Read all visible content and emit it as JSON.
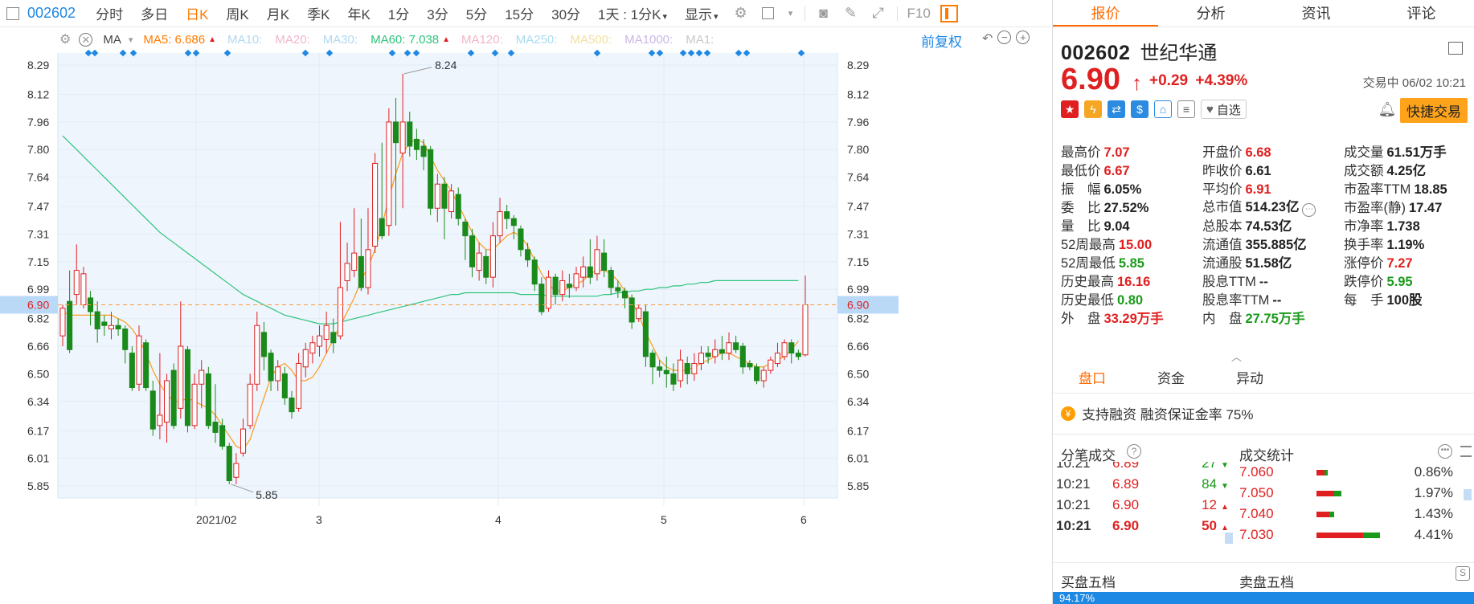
{
  "toolbar": {
    "code": "002602",
    "items": [
      {
        "label": "分时",
        "active": false
      },
      {
        "label": "多日",
        "active": false
      },
      {
        "label": "日K",
        "active": true
      },
      {
        "label": "周K",
        "active": false
      },
      {
        "label": "月K",
        "active": false
      },
      {
        "label": "季K",
        "active": false
      },
      {
        "label": "年K",
        "active": false
      },
      {
        "label": "1分",
        "active": false
      },
      {
        "label": "3分",
        "active": false
      },
      {
        "label": "5分",
        "active": false
      },
      {
        "label": "15分",
        "active": false
      },
      {
        "label": "30分",
        "active": false
      }
    ],
    "dropdown": "1天 : 1分K",
    "display": "显示",
    "f10": "F10"
  },
  "ma_bar": {
    "ma_label": "MA",
    "ma5": {
      "label": "MA5: 6.686",
      "color": "#ff7a00"
    },
    "ma10": {
      "label": "MA10:",
      "color": "#b0d8f0"
    },
    "ma20": {
      "label": "MA20:",
      "color": "#f3b5d0"
    },
    "ma30": {
      "label": "MA30:",
      "color": "#b0d8f0"
    },
    "ma60": {
      "label": "MA60: 7.038",
      "color": "#2ec47b"
    },
    "ma120": {
      "label": "MA120:",
      "color": "#f3b5c4"
    },
    "ma250": {
      "label": "MA250:",
      "color": "#a8dcf0"
    },
    "ma500": {
      "label": "MA500:",
      "color": "#f3e0a0"
    },
    "ma1000": {
      "label": "MA1000:",
      "color": "#c8b8e8"
    },
    "ma1": {
      "label": "MA1:",
      "color": "#c8c8c8"
    },
    "adjust": "前复权"
  },
  "chart_data": {
    "type": "candlestick",
    "y_ticks": [
      "8.29",
      "8.12",
      "7.96",
      "7.80",
      "7.64",
      "7.47",
      "7.31",
      "7.15",
      "6.99",
      "6.82",
      "6.66",
      "6.50",
      "6.34",
      "6.17",
      "6.01",
      "5.85"
    ],
    "y_range": [
      5.78,
      8.36
    ],
    "x_labels": [
      "2021/02",
      "3",
      "4",
      "5",
      "6"
    ],
    "current_price_label": "6.90",
    "current_price": 6.9,
    "max_label": "8.24",
    "min_label": "5.85",
    "candles": [
      [
        6.72,
        6.88,
        6.66,
        6.9
      ],
      [
        6.92,
        6.64,
        6.62,
        7.1
      ],
      [
        6.96,
        7.1,
        6.9,
        7.25
      ],
      [
        6.9,
        7.08,
        6.88,
        7.12
      ],
      [
        6.94,
        6.86,
        6.78,
        6.98
      ],
      [
        6.86,
        6.76,
        6.68,
        6.92
      ],
      [
        6.8,
        6.78,
        6.72,
        6.84
      ],
      [
        6.76,
        6.78,
        6.7,
        6.86
      ],
      [
        6.78,
        6.76,
        6.72,
        6.82
      ],
      [
        6.76,
        6.64,
        6.56,
        6.78
      ],
      [
        6.62,
        6.42,
        6.4,
        6.66
      ],
      [
        6.44,
        6.72,
        6.4,
        6.78
      ],
      [
        6.68,
        6.42,
        6.4,
        6.7
      ],
      [
        6.4,
        6.18,
        6.14,
        6.46
      ],
      [
        6.2,
        6.26,
        6.12,
        6.62
      ],
      [
        6.22,
        6.46,
        6.1,
        6.5
      ],
      [
        6.52,
        6.2,
        6.18,
        6.56
      ],
      [
        6.3,
        6.66,
        6.24,
        6.92
      ],
      [
        6.64,
        6.2,
        6.16,
        6.66
      ],
      [
        6.2,
        6.44,
        6.18,
        6.5
      ],
      [
        6.44,
        6.52,
        6.3,
        6.58
      ],
      [
        6.5,
        6.2,
        6.18,
        6.54
      ],
      [
        6.22,
        6.16,
        6.1,
        6.44
      ],
      [
        6.2,
        6.08,
        6.06,
        6.24
      ],
      [
        6.08,
        5.88,
        5.86,
        6.1
      ],
      [
        5.9,
        5.98,
        5.86,
        6.04
      ],
      [
        6.04,
        6.18,
        6.02,
        6.24
      ],
      [
        6.2,
        6.44,
        6.18,
        6.5
      ],
      [
        6.44,
        6.78,
        6.4,
        6.86
      ],
      [
        6.74,
        6.6,
        6.52,
        6.8
      ],
      [
        6.62,
        6.46,
        6.4,
        6.64
      ],
      [
        6.46,
        6.54,
        6.4,
        6.58
      ],
      [
        6.5,
        6.36,
        6.32,
        6.54
      ],
      [
        6.36,
        6.28,
        6.24,
        6.4
      ],
      [
        6.3,
        6.56,
        6.28,
        6.62
      ],
      [
        6.54,
        6.64,
        6.48,
        6.68
      ],
      [
        6.62,
        6.68,
        6.56,
        6.72
      ],
      [
        6.66,
        6.72,
        6.6,
        6.78
      ],
      [
        6.7,
        6.78,
        6.62,
        6.86
      ],
      [
        6.74,
        6.68,
        6.62,
        6.82
      ],
      [
        6.72,
        7.0,
        6.7,
        7.38
      ],
      [
        7.04,
        7.14,
        6.98,
        7.26
      ],
      [
        7.1,
        7.2,
        7.06,
        7.46
      ],
      [
        7.18,
        7.0,
        6.98,
        7.4
      ],
      [
        7.0,
        7.22,
        6.96,
        7.46
      ],
      [
        7.24,
        7.72,
        7.2,
        7.78
      ],
      [
        7.4,
        7.3,
        7.28,
        7.84
      ],
      [
        7.36,
        7.96,
        7.3,
        8.04
      ],
      [
        7.96,
        7.84,
        7.36,
        8.1
      ],
      [
        7.78,
        7.96,
        7.46,
        8.24
      ],
      [
        7.96,
        7.82,
        7.76,
        8.02
      ],
      [
        7.86,
        7.8,
        7.74,
        7.92
      ],
      [
        7.82,
        7.76,
        7.68,
        7.86
      ],
      [
        7.8,
        7.46,
        7.42,
        7.82
      ],
      [
        7.46,
        7.6,
        7.38,
        7.66
      ],
      [
        7.6,
        7.46,
        7.28,
        7.64
      ],
      [
        7.44,
        7.56,
        7.4,
        7.6
      ],
      [
        7.54,
        7.4,
        7.36,
        7.58
      ],
      [
        7.38,
        7.3,
        7.16,
        7.4
      ],
      [
        7.3,
        7.12,
        7.06,
        7.34
      ],
      [
        7.1,
        7.2,
        7.04,
        7.26
      ],
      [
        7.18,
        7.06,
        7.02,
        7.22
      ],
      [
        7.06,
        7.3,
        7.0,
        7.38
      ],
      [
        7.3,
        7.44,
        7.26,
        7.52
      ],
      [
        7.44,
        7.4,
        7.34,
        7.48
      ],
      [
        7.4,
        7.36,
        7.28,
        7.42
      ],
      [
        7.34,
        7.22,
        7.18,
        7.36
      ],
      [
        7.22,
        7.16,
        7.12,
        7.26
      ],
      [
        7.16,
        7.02,
        6.98,
        7.18
      ],
      [
        7.02,
        6.86,
        6.84,
        7.06
      ],
      [
        6.88,
        7.06,
        6.86,
        7.1
      ],
      [
        7.06,
        6.96,
        6.9,
        7.08
      ],
      [
        6.96,
        7.04,
        6.92,
        7.1
      ],
      [
        7.02,
        7.0,
        6.94,
        7.08
      ],
      [
        7.0,
        7.08,
        6.98,
        7.12
      ],
      [
        7.06,
        7.12,
        7.0,
        7.18
      ],
      [
        7.12,
        7.06,
        7.02,
        7.28
      ],
      [
        7.08,
        7.22,
        7.04,
        7.3
      ],
      [
        7.2,
        7.1,
        7.06,
        7.28
      ],
      [
        7.1,
        7.0,
        6.96,
        7.12
      ],
      [
        7.0,
        6.98,
        6.94,
        7.04
      ],
      [
        6.98,
        6.94,
        6.88,
        7.0
      ],
      [
        6.94,
        6.8,
        6.76,
        6.96
      ],
      [
        6.82,
        6.88,
        6.8,
        6.9
      ],
      [
        6.86,
        6.6,
        6.54,
        6.9
      ],
      [
        6.62,
        6.54,
        6.44,
        6.64
      ],
      [
        6.54,
        6.52,
        6.48,
        6.58
      ],
      [
        6.52,
        6.5,
        6.42,
        6.6
      ],
      [
        6.5,
        6.44,
        6.4,
        6.56
      ],
      [
        6.46,
        6.58,
        6.42,
        6.64
      ],
      [
        6.56,
        6.5,
        6.44,
        6.6
      ],
      [
        6.5,
        6.56,
        6.46,
        6.62
      ],
      [
        6.56,
        6.62,
        6.52,
        6.66
      ],
      [
        6.62,
        6.6,
        6.56,
        6.66
      ],
      [
        6.6,
        6.64,
        6.56,
        6.7
      ],
      [
        6.64,
        6.62,
        6.58,
        6.72
      ],
      [
        6.62,
        6.68,
        6.58,
        6.74
      ],
      [
        6.68,
        6.64,
        6.62,
        6.72
      ],
      [
        6.66,
        6.54,
        6.5,
        6.68
      ],
      [
        6.56,
        6.54,
        6.52,
        6.58
      ],
      [
        6.54,
        6.46,
        6.44,
        6.56
      ],
      [
        6.46,
        6.52,
        6.42,
        6.54
      ],
      [
        6.52,
        6.58,
        6.5,
        6.6
      ],
      [
        6.56,
        6.62,
        6.54,
        6.68
      ],
      [
        6.6,
        6.68,
        6.58,
        6.7
      ],
      [
        6.68,
        6.62,
        6.56,
        6.7
      ],
      [
        6.62,
        6.6,
        6.58,
        6.64
      ],
      [
        6.61,
        6.9,
        6.6,
        7.07
      ]
    ],
    "ma5": [
      6.86,
      6.84,
      6.84,
      6.84,
      6.84,
      6.84,
      6.84,
      6.84,
      6.82,
      6.8,
      6.76,
      6.7,
      6.62,
      6.52,
      6.44,
      6.38,
      6.34,
      6.34,
      6.36,
      6.34,
      6.32,
      6.3,
      6.26,
      6.2,
      6.14,
      6.08,
      6.06,
      6.12,
      6.24,
      6.36,
      6.48,
      6.54,
      6.56,
      6.52,
      6.46,
      6.46,
      6.48,
      6.54,
      6.62,
      6.7,
      6.78,
      6.86,
      6.94,
      7.04,
      7.12,
      7.22,
      7.36,
      7.52,
      7.66,
      7.78,
      7.84,
      7.86,
      7.84,
      7.76,
      7.68,
      7.62,
      7.56,
      7.48,
      7.4,
      7.32,
      7.26,
      7.22,
      7.22,
      7.26,
      7.3,
      7.32,
      7.3,
      7.24,
      7.16,
      7.08,
      7.02,
      6.98,
      6.98,
      7.0,
      7.02,
      7.04,
      7.08,
      7.1,
      7.1,
      7.08,
      7.04,
      6.98,
      6.92,
      6.84,
      6.74,
      6.66,
      6.58,
      6.54,
      6.52,
      6.52,
      6.52,
      6.54,
      6.56,
      6.58,
      6.6,
      6.62,
      6.62,
      6.6,
      6.58,
      6.56,
      6.54,
      6.54,
      6.56,
      6.58,
      6.6,
      6.64,
      6.69
    ],
    "ma60": [
      7.88,
      7.84,
      7.8,
      7.76,
      7.72,
      7.68,
      7.64,
      7.6,
      7.56,
      7.52,
      7.48,
      7.44,
      7.4,
      7.36,
      7.32,
      7.29,
      7.26,
      7.23,
      7.2,
      7.17,
      7.14,
      7.11,
      7.08,
      7.05,
      7.02,
      6.99,
      6.96,
      6.94,
      6.92,
      6.9,
      6.88,
      6.86,
      6.84,
      6.83,
      6.82,
      6.81,
      6.8,
      6.79,
      6.79,
      6.79,
      6.8,
      6.81,
      6.82,
      6.83,
      6.84,
      6.85,
      6.86,
      6.87,
      6.88,
      6.89,
      6.9,
      6.91,
      6.92,
      6.93,
      6.94,
      6.95,
      6.96,
      6.96,
      6.97,
      6.97,
      6.97,
      6.97,
      6.97,
      6.97,
      6.97,
      6.97,
      6.96,
      6.96,
      6.96,
      6.96,
      6.95,
      6.95,
      6.95,
      6.95,
      6.95,
      6.95,
      6.95,
      6.95,
      6.96,
      6.96,
      6.97,
      6.97,
      6.98,
      6.98,
      6.99,
      6.99,
      7.0,
      7.0,
      7.01,
      7.01,
      7.02,
      7.02,
      7.03,
      7.03,
      7.04,
      7.04,
      7.04,
      7.04,
      7.04,
      7.04,
      7.04,
      7.04,
      7.04,
      7.04,
      7.04,
      7.04,
      7.04
    ]
  },
  "panel": {
    "tabs": [
      {
        "label": "报价",
        "active": true
      },
      {
        "label": "分析",
        "active": false
      },
      {
        "label": "资讯",
        "active": false
      },
      {
        "label": "评论",
        "active": false
      }
    ],
    "code": "002602",
    "name": "世纪华通",
    "price": "6.90",
    "change": "+0.29",
    "change_pct": "+4.39%",
    "status": "交易中 06/02 10:21",
    "fav_label": "自选",
    "trade_button": "快捷交易",
    "stats": [
      [
        {
          "k": "最高价",
          "v": "7.07",
          "c": "red"
        },
        {
          "k": "开盘价",
          "v": "6.68",
          "c": "red"
        },
        {
          "k": "成交量",
          "v": "61.51万手",
          "c": "dark"
        }
      ],
      [
        {
          "k": "最低价",
          "v": "6.67",
          "c": "red"
        },
        {
          "k": "昨收价",
          "v": "6.61",
          "c": "dark"
        },
        {
          "k": "成交额",
          "v": "4.25亿",
          "c": "dark"
        }
      ],
      [
        {
          "k": "振　幅",
          "v": "6.05%",
          "c": "dark"
        },
        {
          "k": "平均价",
          "v": "6.91",
          "c": "red"
        },
        {
          "k": "市盈率TTM",
          "v": "18.85",
          "c": "dark"
        }
      ],
      [
        {
          "k": "委　比",
          "v": "27.52%",
          "c": "dark"
        },
        {
          "k": "总市值",
          "v": "514.23亿",
          "c": "dark"
        },
        {
          "k": "市盈率(静)",
          "v": "17.47",
          "c": "dark"
        }
      ],
      [
        {
          "k": "量　比",
          "v": "9.04",
          "c": "dark"
        },
        {
          "k": "总股本",
          "v": "74.53亿",
          "c": "dark"
        },
        {
          "k": "市净率",
          "v": "1.738",
          "c": "dark"
        }
      ],
      [
        {
          "k": "52周最高",
          "v": "15.00",
          "c": "red"
        },
        {
          "k": "流通值",
          "v": "355.885亿",
          "c": "dark"
        },
        {
          "k": "换手率",
          "v": "1.19%",
          "c": "dark"
        }
      ],
      [
        {
          "k": "52周最低",
          "v": "5.85",
          "c": "green"
        },
        {
          "k": "流通股",
          "v": "51.58亿",
          "c": "dark"
        },
        {
          "k": "涨停价",
          "v": "7.27",
          "c": "red"
        }
      ],
      [
        {
          "k": "历史最高",
          "v": "16.16",
          "c": "red"
        },
        {
          "k": "股息TTM",
          "v": "--",
          "c": "dark"
        },
        {
          "k": "跌停价",
          "v": "5.95",
          "c": "green"
        }
      ],
      [
        {
          "k": "历史最低",
          "v": "0.80",
          "c": "green"
        },
        {
          "k": "股息率TTM",
          "v": "--",
          "c": "dark"
        },
        {
          "k": "每　手",
          "v": "100股",
          "c": "dark"
        }
      ],
      [
        {
          "k": "外　盘",
          "v": "33.29万手",
          "c": "red"
        },
        {
          "k": "内　盘",
          "v": "27.75万手",
          "c": "green"
        },
        {
          "k": "",
          "v": "",
          "c": "dark"
        }
      ]
    ],
    "subtabs": [
      {
        "label": "盘口",
        "active": true
      },
      {
        "label": "资金",
        "active": false
      },
      {
        "label": "异动",
        "active": false
      }
    ],
    "margin_text": "支持融资  融资保证金率 75%",
    "ticks_title": "分笔成交",
    "stats_title": "成交统计",
    "ticks": [
      {
        "t": "10:21",
        "p": "6.89",
        "v": "27",
        "dir": "down",
        "bold": false
      },
      {
        "t": "10:21",
        "p": "6.89",
        "v": "84",
        "dir": "down",
        "bold": false
      },
      {
        "t": "10:21",
        "p": "6.90",
        "v": "12",
        "dir": "up",
        "bold": false
      },
      {
        "t": "10:21",
        "p": "6.90",
        "v": "50",
        "dir": "up",
        "bold": true
      }
    ],
    "volume_stats": [
      {
        "p": "7.060",
        "buy": 0.55,
        "sell": 0.25,
        "pct": "0.86%"
      },
      {
        "p": "7.050",
        "buy": 1.2,
        "sell": 0.5,
        "pct": "1.97%"
      },
      {
        "p": "7.040",
        "buy": 0.9,
        "sell": 0.3,
        "pct": "1.43%"
      },
      {
        "p": "7.030",
        "buy": 3.2,
        "sell": 1.2,
        "pct": "4.41%"
      }
    ],
    "buy_book_title": "买盘五档",
    "sell_book_title": "卖盘五档",
    "book_pct": "94.17%"
  },
  "colors": {
    "up": "#e02020",
    "down": "#1a8a1a",
    "accent": "#ff7a00",
    "blue": "#1e88e5",
    "ma5": "#ff9a1a",
    "ma60": "#2ec47b"
  }
}
